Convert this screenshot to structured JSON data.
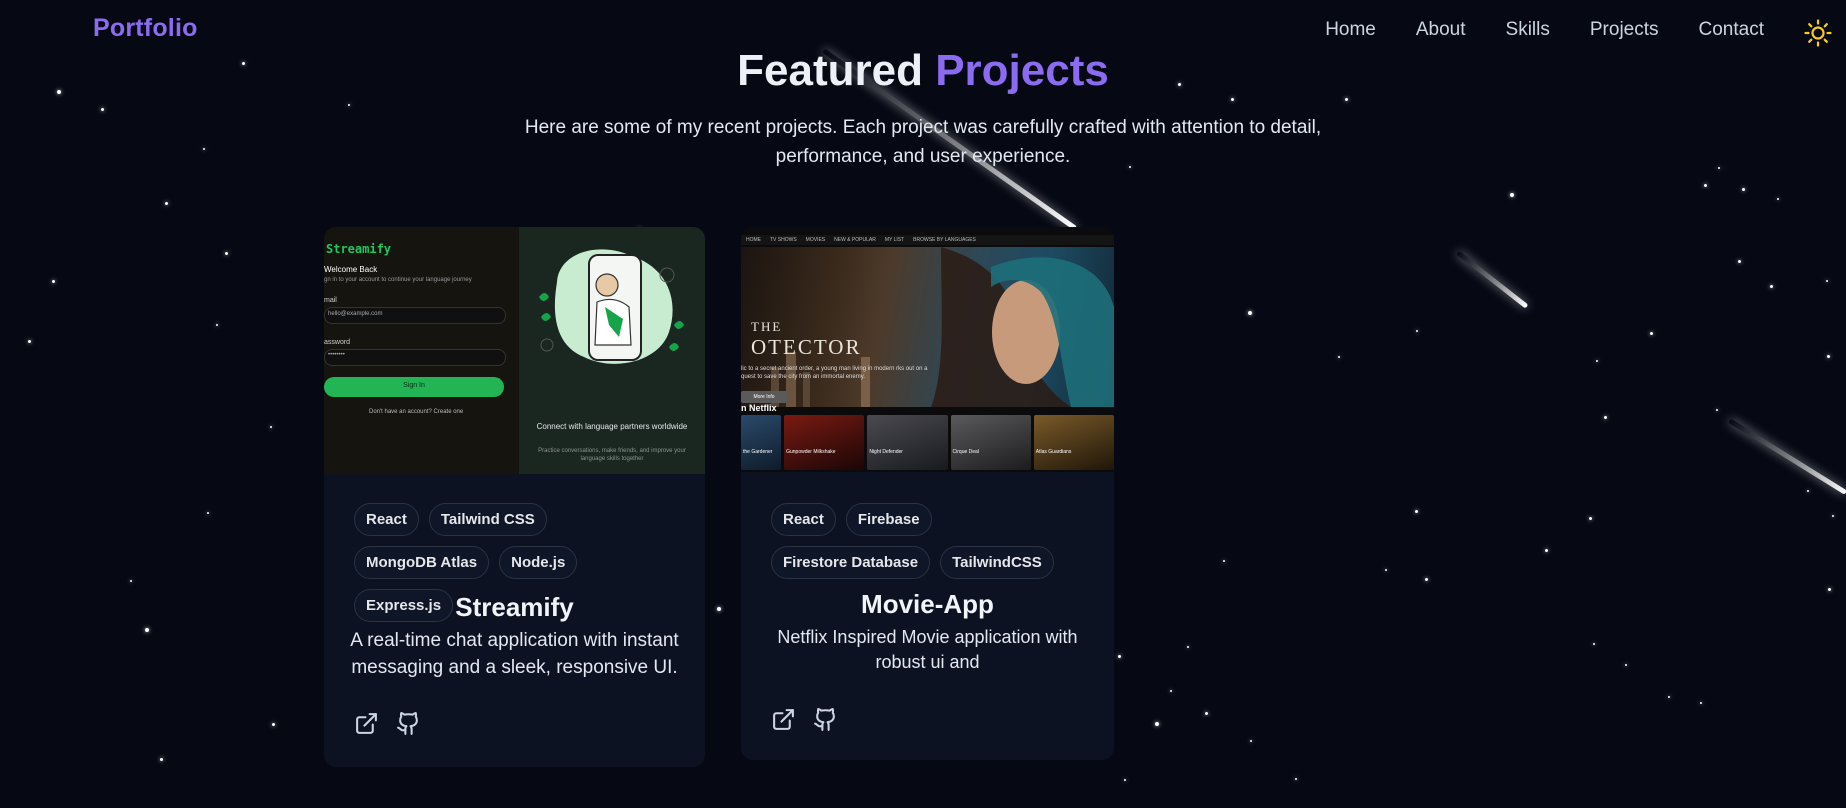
{
  "nav": {
    "logo": "Portfolio",
    "links": [
      "Home",
      "About",
      "Skills",
      "Projects",
      "Contact"
    ],
    "theme_icon": "sun-icon",
    "accent_color": "#8b6bf0",
    "sun_color": "#facc15"
  },
  "section": {
    "title_part1": "Featured",
    "title_part2": "Projects",
    "subtitle": "Here are some of my recent projects. Each project was carefully crafted with attention to detail, performance, and user experience."
  },
  "projects": [
    {
      "title": "Streamify",
      "description": "A real-time chat application with instant messaging and a sleek, responsive UI.",
      "tags": [
        "React",
        "Tailwind CSS",
        "MongoDB Atlas",
        "Node.js",
        "Express.js"
      ],
      "actions": [
        "external-link-icon",
        "github-icon"
      ],
      "preview": {
        "brand": "Streamify",
        "heading": "Welcome Back",
        "subheading": "gn in to your account to continue your language journey",
        "email_label": "mail",
        "email_value": "hello@example.com",
        "password_label": "assword",
        "password_value": "••••••••",
        "button": "Sign In",
        "signup_text": "Don't have an account? Create one",
        "caption": "Connect with language partners worldwide",
        "caption_sub": "Practice conversations, make friends, and improve your language skills together"
      }
    },
    {
      "title": "Movie-App",
      "description": "Netflix Inspired Movie application with robust ui and",
      "tags": [
        "React",
        "Firebase",
        "Firestore Database",
        "TailwindCSS"
      ],
      "actions": [
        "external-link-icon",
        "github-icon"
      ],
      "preview": {
        "nav": [
          "HOME",
          "TV SHOWS",
          "MOVIES",
          "NEW & POPULAR",
          "MY LIST",
          "BROWSE BY LANGUAGES"
        ],
        "title_line1": "THE",
        "title_line2": "OTECTOR",
        "hero_text": "lic to a secret ancient order, a young man living in modern rks out on a quest to save the city from an immortal enemy.",
        "more_button": "More Info",
        "row_label": "n Netflix",
        "tiles": [
          "the Gardener",
          "Gunpowder Milkshake",
          "Night Defender",
          "Cirque Deal",
          "Atlas Guardians"
        ]
      }
    }
  ]
}
